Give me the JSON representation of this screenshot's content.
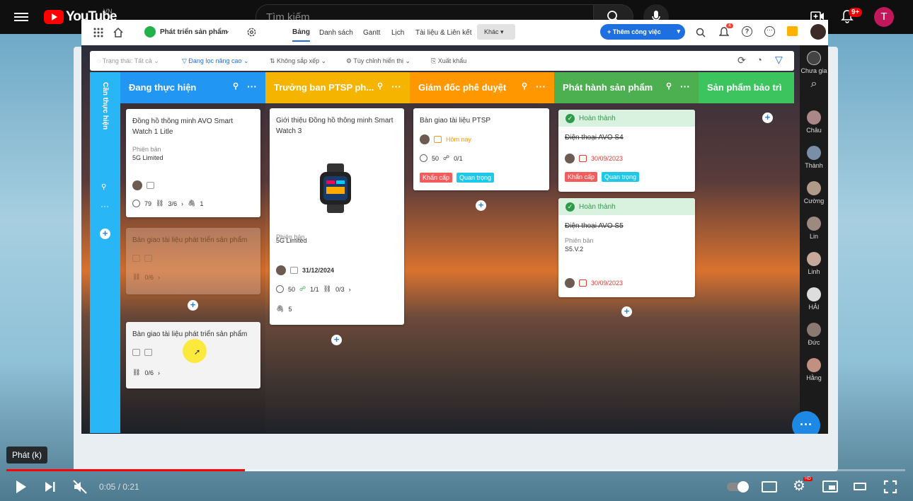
{
  "youtube": {
    "logo_text": "YouTube",
    "region": "VN",
    "search_placeholder": "Tìm kiếm",
    "notification_count": "9+",
    "avatar_letter": "T"
  },
  "app": {
    "project": "Phát triển sản phẩm",
    "views": [
      "Bảng",
      "Danh sách",
      "Gantt",
      "Lịch",
      "Tài liệu & Liên kết",
      "Khác"
    ],
    "add_task": "Thêm công việc",
    "notif_count": "4"
  },
  "toolbar": {
    "status": "Trạng thái: Tất cả",
    "filter": "Đang lọc nâng cao",
    "sort": "Không sắp xếp",
    "display": "Tùy chỉnh hiển thị",
    "export": "Xuất khẩu"
  },
  "collapsed_lane": "Cần thực hiện",
  "lanes": [
    {
      "title": "Đang thực hiện",
      "color": "#2196f3"
    },
    {
      "title": "Trưởng ban PTSP ph...",
      "color": "#f5b400"
    },
    {
      "title": "Giám đốc phê duyệt",
      "color": "#ff9800"
    },
    {
      "title": "Phát hành sản phẩm",
      "color": "#4caf50"
    },
    {
      "title": "Sản phẩm bảo trì",
      "color": "#3cc45f"
    }
  ],
  "cards": {
    "c1": {
      "title": "Đồng hồ thông minh AVO Smart Watch 1 Litle",
      "label": "Phiên bản",
      "value": "5G Limited",
      "progress": "79",
      "sub": "3/6",
      "attach": "1"
    },
    "c2": {
      "title": "Bàn giao tài liệu phát triển sản phẩm",
      "sub": "0/6"
    },
    "c3": {
      "title": "Bàn giao tài liệu phát triển sản phẩm",
      "sub": "0/6"
    },
    "c4": {
      "title": "Giới thiệu Đồng hồ thông minh Smart Watch 3",
      "label": "Phiên bản",
      "value": "5G Limited",
      "date": "31/12/2024",
      "progress": "50",
      "assign": "1/1",
      "sub": "0/3",
      "attach": "5"
    },
    "c5": {
      "title": "Bàn giao tài liệu PTSP",
      "date": "Hôm nay",
      "progress": "50",
      "assign": "0/1",
      "tag1": "Khẩn cấp",
      "tag2": "Quan trọng"
    },
    "c6": {
      "status": "Hoàn thành",
      "title": "Điện thoại AVO S4",
      "date": "30/09/2023",
      "tag1": "Khẩn cấp",
      "tag2": "Quan trọng"
    },
    "c7": {
      "status": "Hoàn thành",
      "title": "Điện thoại AVO S5",
      "label": "Phiên bản",
      "value": "S5.V.2",
      "date": "30/09/2023"
    }
  },
  "sidebar_users": [
    "Chưa gia",
    "Châu",
    "Thành",
    "Cường",
    "Lin",
    "Linh",
    "HẢI",
    "Đức",
    "Hằng"
  ],
  "player": {
    "tooltip": "Phát (k)",
    "time": "0:05 / 0:21",
    "progress_percent": 26.5
  }
}
